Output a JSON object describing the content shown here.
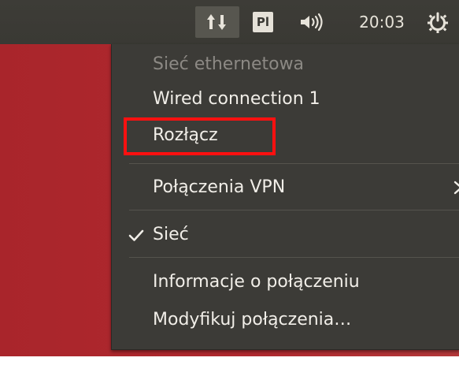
{
  "panel": {
    "clock": "20:03",
    "keyboard_layout": "Pl",
    "icons": {
      "network": "network-updown-icon",
      "sound": "speaker-volume-icon",
      "power": "power-gear-icon"
    }
  },
  "menu": {
    "ethernet_header": "Sieć ethernetowa",
    "wired_connection": "Wired connection 1",
    "disconnect": "Rozłącz",
    "vpn_connections": "Połączenia VPN",
    "network_toggle": "Sieć",
    "connection_info": "Informacje o połączeniu",
    "edit_connections": "Modyfikuj połączenia…"
  },
  "annotation": {
    "highlight_color": "#ff1010"
  },
  "colors": {
    "desktop": "#a9252b",
    "panel": "#3c3b37",
    "menu_bg": "#3c3b37",
    "menu_text": "#f1eee8",
    "menu_disabled_text": "#8c8984"
  }
}
